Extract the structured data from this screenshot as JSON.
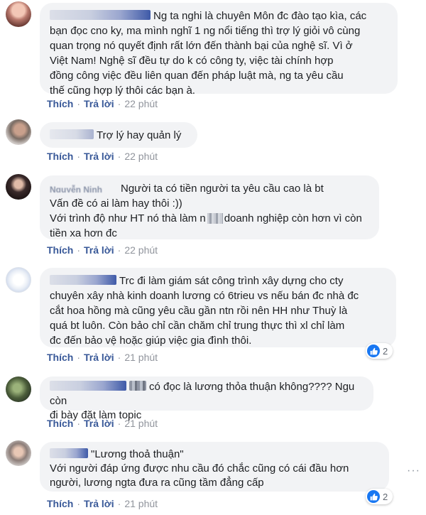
{
  "actions": {
    "like": "Thích",
    "reply": "Trả lời",
    "separator": "·"
  },
  "comments": [
    {
      "lines": [
        "Ng ta nghi là chuyên Môn đc đào tạo kìa, các",
        "bạn đọc cno ky, ma mình nghĩ 1 ng nổi tiếng thì trợ lý giỏi vô cùng",
        "quan trọng nó quyết định rất lớn đến thành bại của nghệ sĩ. Vì ở",
        "Việt Nam! Nghệ sĩ đều tự do k có công ty, việc tài chính hợp",
        "đồng công việc đều liên quan đến pháp luật mà, ng ta yêu cầu",
        "thế cũng hợp lý thôi các bạn à."
      ],
      "time": "22 phút"
    },
    {
      "lines": [
        "Trợ lý hay quản lý"
      ],
      "time": "22 phút"
    },
    {
      "name_visible": "Nguyễn Ninh",
      "lines": [
        "Người ta có tiền người ta yêu cầu cao là bt",
        "Vấn đề có ai làm hay thôi :))",
        "Với trình độ như HT nó thà làm n",
        "doanh nghiệp còn hơn vì còn",
        "tiền xa hơn đc"
      ],
      "time": "22 phút"
    },
    {
      "lines": [
        "Trc đi làm giám sát công trình xây dựng cho cty",
        "chuyên xây nhà kinh doanh lương có 6trieu vs nếu bán đc nhà đc",
        "cắt hoa hồng mà cũng yêu cầu gần ntn rồi nên HH như Thuỳ là",
        "quá bt luôn. Còn bảo chỉ cần chăm chỉ trung thực thì xl chỉ làm",
        "đc đến bảo vệ hoặc giúp việc gia đình thôi."
      ],
      "reactions": "2",
      "time": "21 phút"
    },
    {
      "lines": [
        "có đọc là lương thỏa thuận không???? Ngu còn",
        "đi bày đặt làm topic"
      ],
      "time": "21 phút"
    },
    {
      "lines": [
        "\"Lương thoả thuận\"",
        "Với người đáp ứng được nhu cầu đó chắc cũng có cái đầu hơn",
        "người, lương ngta đưa ra cũng tầm đẳng cấp"
      ],
      "reactions": "2",
      "time": "21 phút"
    }
  ],
  "icons": {
    "like": "thumbs-up-icon",
    "more": "more-options-icon"
  },
  "colors": {
    "bubble": "#f2f3f5",
    "link": "#385898",
    "meta": "#90949c",
    "like_blue": "#1877f2"
  }
}
